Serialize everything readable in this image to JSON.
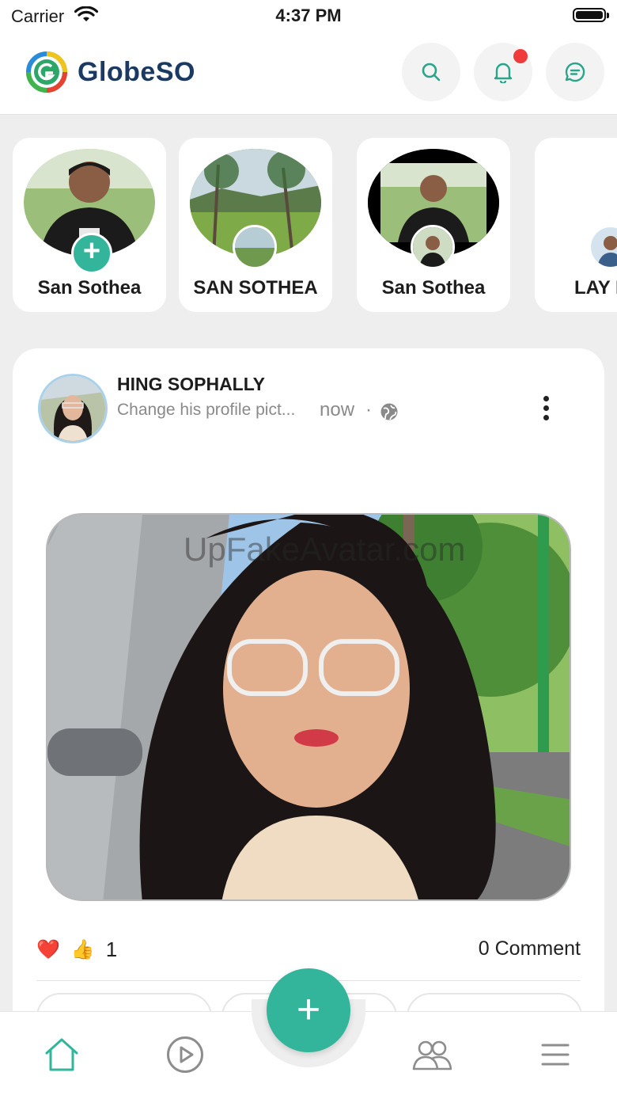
{
  "status_bar": {
    "carrier": "Carrier",
    "time": "4:37 PM"
  },
  "header": {
    "brand": "GlobeSO",
    "icons": [
      "search-icon",
      "bell-icon",
      "chat-icon"
    ],
    "has_notification": true
  },
  "stories": [
    {
      "name": "San Sothea",
      "type": "create",
      "badge": "plus-icon"
    },
    {
      "name": "SAN SOTHEA",
      "type": "story"
    },
    {
      "name": "San Sothea",
      "type": "story"
    },
    {
      "name": "LAY H",
      "type": "story"
    }
  ],
  "post": {
    "author": "HING SOPHALLY",
    "action": "Change his profile pict...",
    "time": "now",
    "separator": "·",
    "audience_icon": "globe-icon",
    "watermark": "UpFakeAvatar.com",
    "reactions": [
      "heart-emoji",
      "thumbs-up-emoji"
    ],
    "heart": "❤️",
    "thumb": "👍",
    "reaction_count": "1",
    "comments": "0 Comment"
  },
  "bottom_nav": {
    "items": [
      "home-icon",
      "play-icon",
      "add-icon",
      "friends-icon",
      "menu-icon"
    ],
    "active": "home-icon",
    "fab_label": "+"
  },
  "colors": {
    "accent": "#33b59c",
    "brand_text": "#1b3a63",
    "notification": "#ef3b3b"
  }
}
